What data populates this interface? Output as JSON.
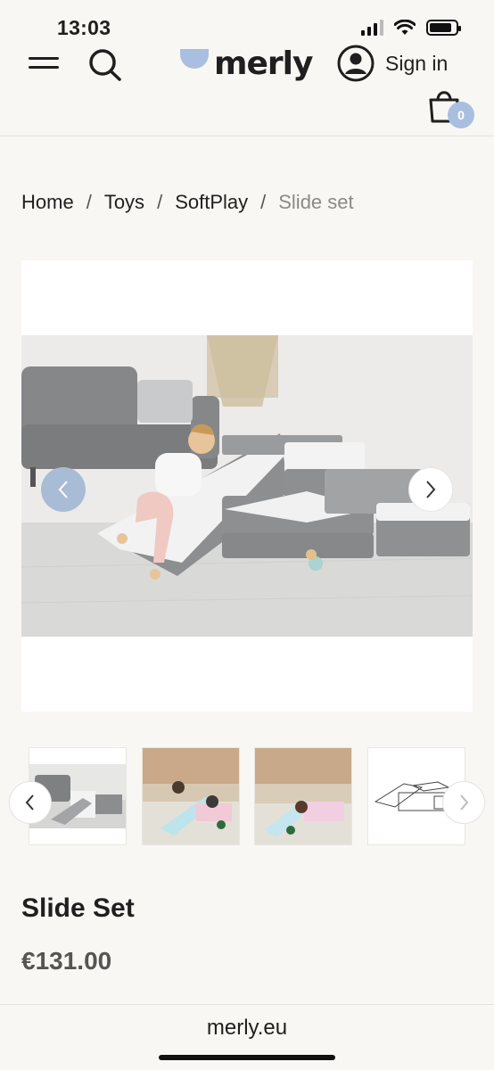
{
  "status_bar": {
    "time": "13:03",
    "battery_level": 0.85
  },
  "header": {
    "logo_text": "merly",
    "signin_label": "Sign in",
    "cart_count": "0"
  },
  "breadcrumb": {
    "items": [
      "Home",
      "Toys",
      "SoftPlay",
      "Slide set"
    ],
    "separator": "/"
  },
  "product": {
    "title": "Slide Set",
    "price": "€131.00"
  },
  "colors": {
    "accent": "#a9bfe0",
    "background": "#f8f7f3"
  },
  "address_bar": {
    "url": "merly.eu"
  }
}
